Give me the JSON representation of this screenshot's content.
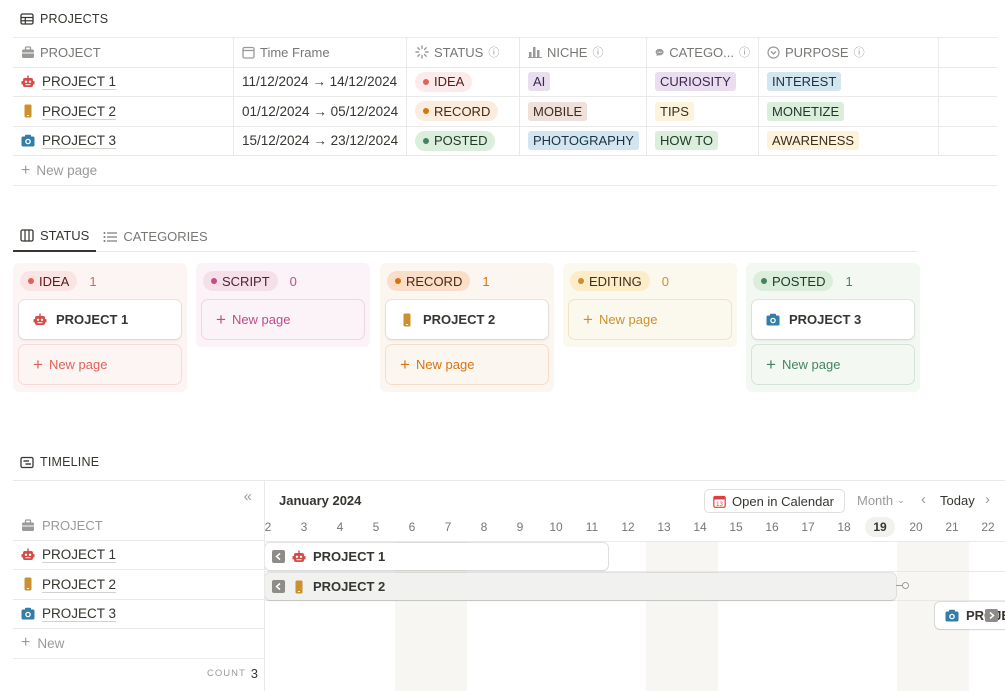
{
  "projects_db": {
    "title": "PROJECTS",
    "columns": [
      "PROJECT",
      "Time Frame",
      "STATUS",
      "NICHE",
      "CATEGO...",
      "PURPOSE"
    ],
    "rows": [
      {
        "name": "PROJECT 1",
        "icon": "robot-icon",
        "time": "11/12/2024 → 14/12/2024",
        "status": "IDEA",
        "niche": "AI",
        "category": "CURIOSITY",
        "purpose": "INTEREST"
      },
      {
        "name": "PROJECT 2",
        "icon": "phone-icon",
        "time": "01/12/2024 → 05/12/2024",
        "status": "RECORD",
        "niche": "MOBILE",
        "category": "TIPS",
        "purpose": "MONETIZE"
      },
      {
        "name": "PROJECT 3",
        "icon": "camera-icon",
        "time": "15/12/2024 → 23/12/2024",
        "status": "POSTED",
        "niche": "PHOTOGRAPHY",
        "category": "HOW TO",
        "purpose": "AWARENESS"
      }
    ],
    "new_page": "New page"
  },
  "board": {
    "tabs": [
      "STATUS",
      "CATEGORIES"
    ],
    "columns": [
      {
        "label": "IDEA",
        "count": "1",
        "card": "PROJECT 1",
        "new": "New page"
      },
      {
        "label": "SCRIPT",
        "count": "0",
        "new": "New page"
      },
      {
        "label": "RECORD",
        "count": "1",
        "card": "PROJECT 2",
        "new": "New page"
      },
      {
        "label": "EDITING",
        "count": "0",
        "new": "New page"
      },
      {
        "label": "POSTED",
        "count": "1",
        "card": "PROJECT 3",
        "new": "New page"
      }
    ]
  },
  "timeline": {
    "title": "TIMELINE",
    "month": "January 2024",
    "open_calendar": "Open in Calendar",
    "scale": "Month",
    "today": "Today",
    "header": "PROJECT",
    "rows": [
      "PROJECT 1",
      "PROJECT 2",
      "PROJECT 3"
    ],
    "bar_labels": [
      "PROJECT 1",
      "PROJECT 2",
      "PROJE"
    ],
    "new": "New",
    "count_label": "COUNT",
    "count": "3",
    "days": [
      "2",
      "3",
      "4",
      "5",
      "6",
      "7",
      "8",
      "9",
      "10",
      "11",
      "12",
      "13",
      "14",
      "15",
      "16",
      "17",
      "18",
      "19",
      "20",
      "21",
      "22"
    ],
    "current_day": "19"
  },
  "colors": {
    "idea": "#e16259",
    "record": "#d9730d",
    "posted": "#448361",
    "script": "#ad1a72",
    "editing": "#cb912f"
  }
}
